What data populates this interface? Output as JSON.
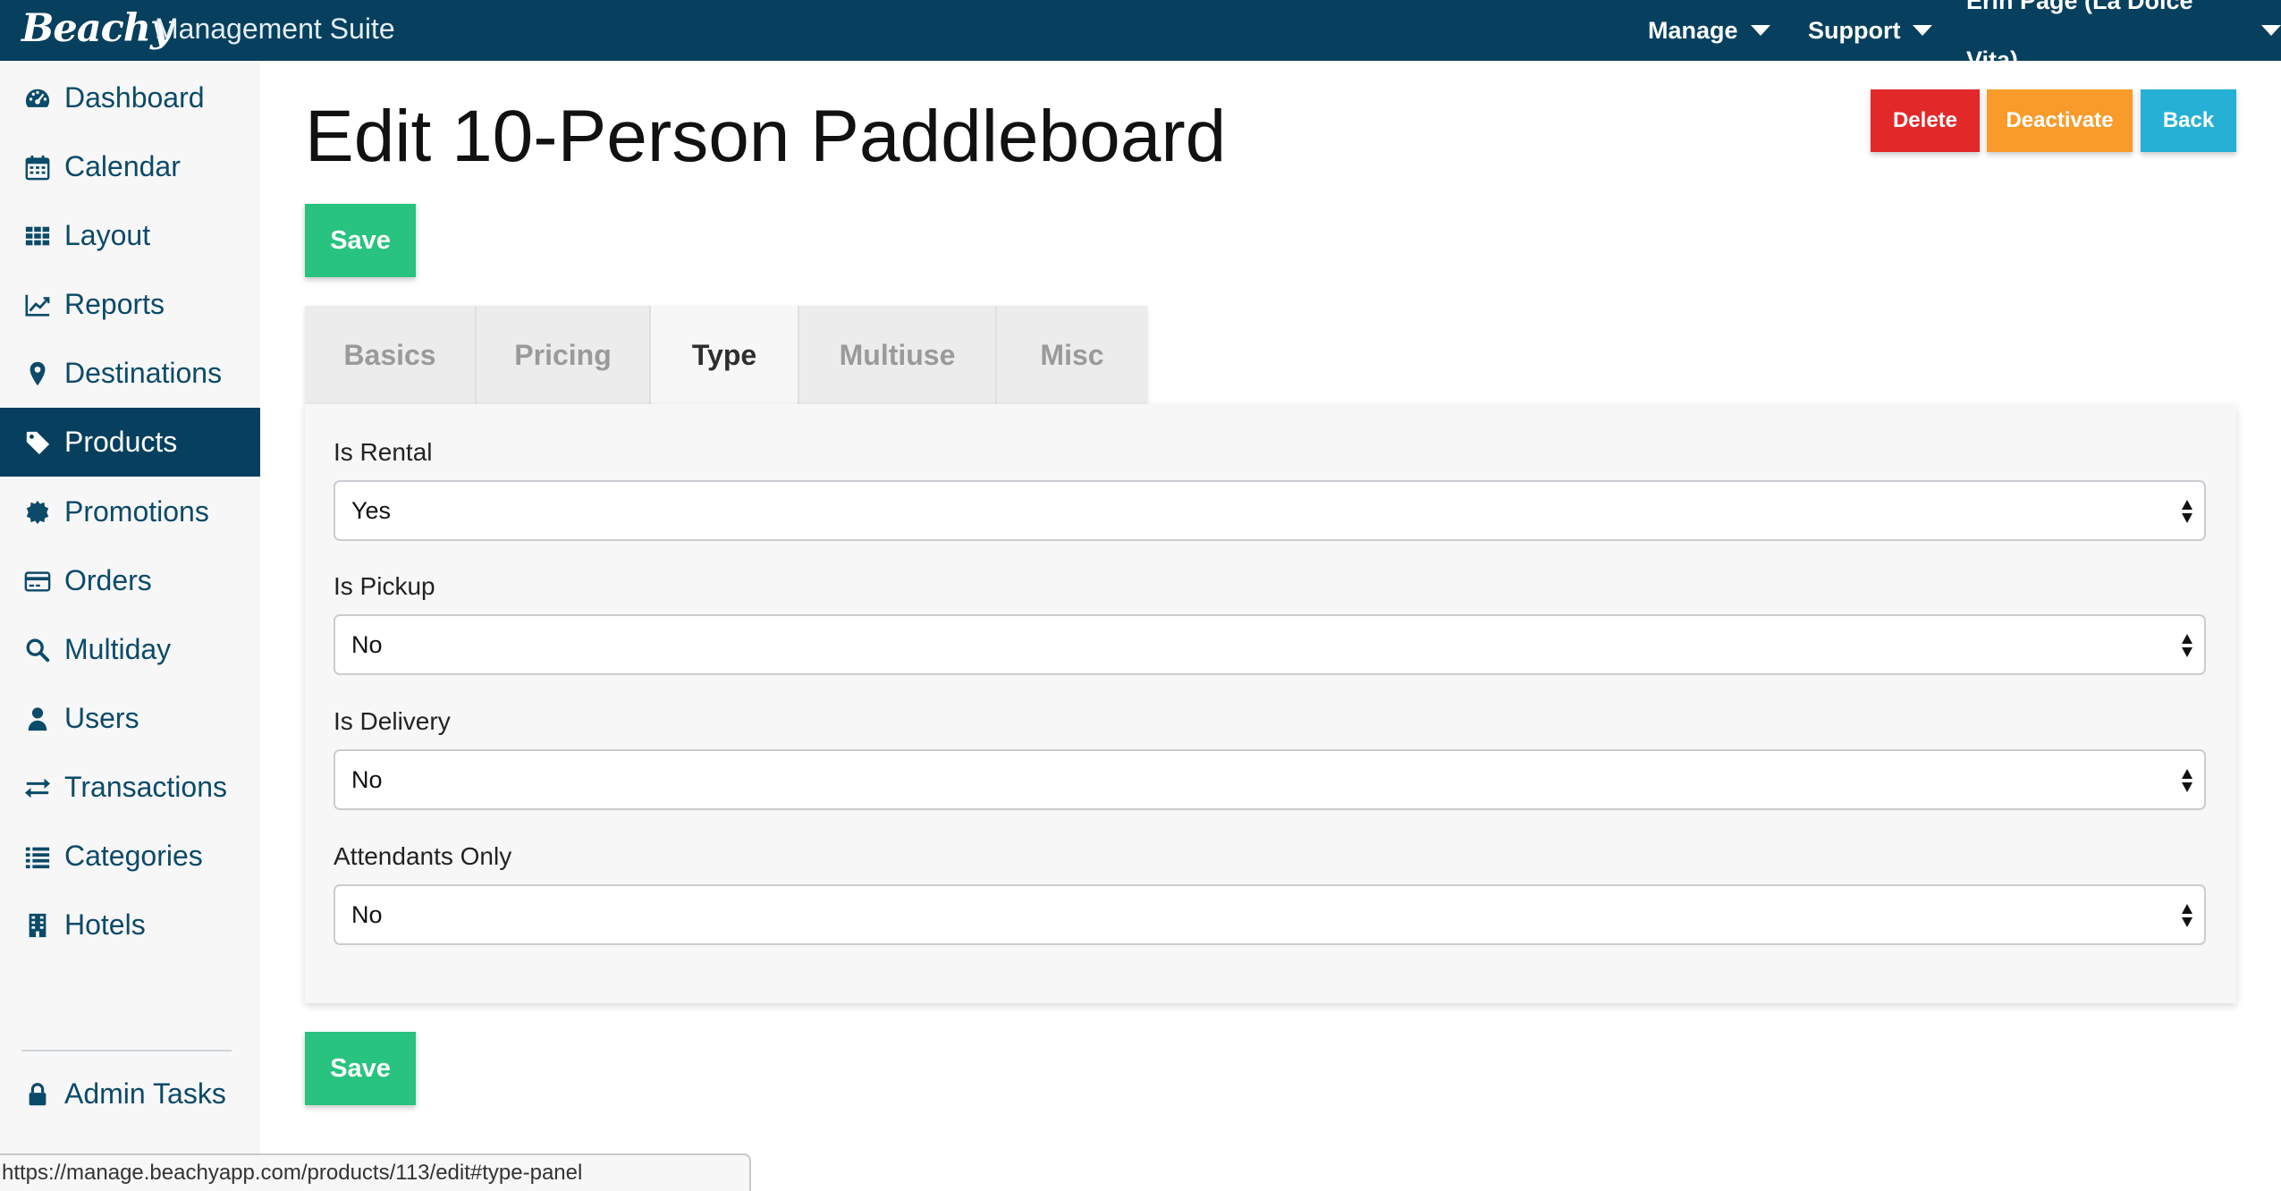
{
  "topbar": {
    "brand": "Beachy",
    "suite": "Management Suite",
    "nav": [
      {
        "label": "Manage"
      },
      {
        "label": "Support"
      },
      {
        "label": "Erin Page (La Dolce Vita)"
      }
    ],
    "background": "#06405e"
  },
  "sidebar": {
    "items": [
      {
        "label": "Dashboard",
        "icon": "dashboard-icon"
      },
      {
        "label": "Calendar",
        "icon": "calendar-icon"
      },
      {
        "label": "Layout",
        "icon": "grid-icon"
      },
      {
        "label": "Reports",
        "icon": "chart-line-icon"
      },
      {
        "label": "Destinations",
        "icon": "map-marker-icon"
      },
      {
        "label": "Products",
        "icon": "tag-icon",
        "active": true
      },
      {
        "label": "Promotions",
        "icon": "certificate-icon"
      },
      {
        "label": "Orders",
        "icon": "credit-card-icon"
      },
      {
        "label": "Multiday",
        "icon": "search-icon"
      },
      {
        "label": "Users",
        "icon": "user-icon"
      },
      {
        "label": "Transactions",
        "icon": "exchange-icon"
      },
      {
        "label": "Categories",
        "icon": "list-icon"
      },
      {
        "label": "Hotels",
        "icon": "building-icon"
      }
    ],
    "admin": {
      "label": "Admin Tasks",
      "icon": "lock-icon"
    }
  },
  "main": {
    "title": "Edit 10-Person Paddleboard",
    "actions": {
      "delete": "Delete",
      "deactivate": "Deactivate",
      "back": "Back"
    },
    "save_label": "Save",
    "tabs": [
      {
        "label": "Basics"
      },
      {
        "label": "Pricing"
      },
      {
        "label": "Type",
        "active": true
      },
      {
        "label": "Multiuse"
      },
      {
        "label": "Misc"
      }
    ],
    "fields": [
      {
        "label": "Is Rental",
        "value": "Yes"
      },
      {
        "label": "Is Pickup",
        "value": "No"
      },
      {
        "label": "Is Delivery",
        "value": "No"
      },
      {
        "label": "Attendants Only",
        "value": "No"
      }
    ]
  },
  "status_url": "https://manage.beachyapp.com/products/113/edit#type-panel",
  "colors": {
    "navy": "#06405e",
    "delete": "#e3282a",
    "deactivate": "#f89b2a",
    "back": "#27b0d6",
    "save": "#27c37f"
  }
}
